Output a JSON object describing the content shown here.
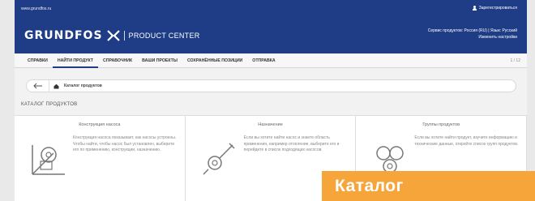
{
  "header": {
    "url": "www.grundfos.ru",
    "account": "Зарегистрироваться",
    "logo_word": "GRUNDFOS",
    "logo_sub": "PRODUCT CENTER",
    "links_line1": "Сервис продуктов: Россия (RU) | Язык: Русский",
    "links_line2": "Изменить настройки"
  },
  "nav": {
    "items": [
      "СПРАВКИ",
      "НАЙТИ ПРОДУКТ",
      "СПРАВОЧНИК",
      "ВАШИ ПРОЕКТЫ",
      "СОХРАНЁННЫЕ ПОЗИЦИИ",
      "ОТПРАВКА"
    ],
    "right": "1 / 12"
  },
  "breadcrumb": {
    "current": "Каталог продуктов"
  },
  "section_title": "КАТАЛОГ ПРОДУКТОВ",
  "cards": [
    {
      "title": "Конструкция насоса",
      "desc": "Конструкция насоса показывает, как насосы устроены. Чтобы найти, чтобы насос был установлен, выберите его по применению, конструкции, назначению."
    },
    {
      "title": "Назначение",
      "desc": "Если вы хотите найти насос и знаете область применения, например отопление, выберите его и перейдите в список подходящих насосов."
    },
    {
      "title": "Группы продуктов",
      "desc": "Если вы хотите найти продукт, изучите информацию и технические данные, откройте список групп продуктов."
    }
  ],
  "banner": "Каталог",
  "colors": {
    "brand": "#1f3d86",
    "banner": "#f5a53a"
  }
}
